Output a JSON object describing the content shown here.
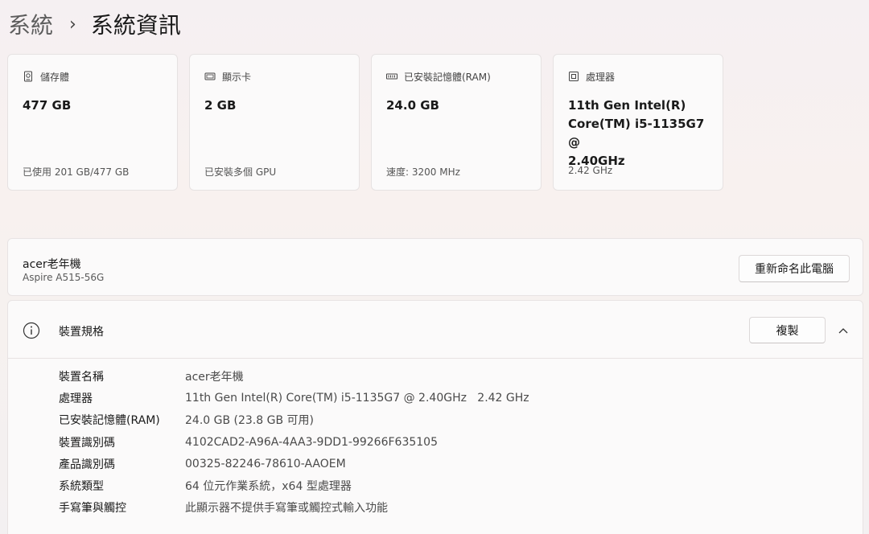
{
  "breadcrumb": {
    "parent": "系統",
    "separator": "›",
    "current": "系統資訊"
  },
  "cards": [
    {
      "icon": "storage-icon",
      "title": "儲存體",
      "value": "477 GB",
      "sub": "已使用 201 GB/477 GB"
    },
    {
      "icon": "display-adapter-icon",
      "title": "顯示卡",
      "value": "2 GB",
      "sub": "已安裝多個 GPU"
    },
    {
      "icon": "memory-icon",
      "title": "已安裝記憶體(RAM)",
      "value": "24.0 GB",
      "sub": "速度: 3200 MHz"
    },
    {
      "icon": "processor-icon",
      "title": "處理器",
      "value_lines": [
        "11th Gen Intel(R)",
        "Core(TM) i5-1135G7 @",
        "2.40GHz"
      ],
      "sub": "2.42 GHz"
    }
  ],
  "device": {
    "name": "acer老年機",
    "model": "Aspire A515-56G",
    "rename_label": "重新命名此電腦"
  },
  "specs": {
    "title": "裝置規格",
    "copy_label": "複製",
    "rows": [
      {
        "label": "裝置名稱",
        "value": "acer老年機"
      },
      {
        "label": "處理器",
        "value": "11th Gen Intel(R) Core(TM) i5-1135G7 @ 2.40GHz   2.42 GHz"
      },
      {
        "label": "已安裝記憶體(RAM)",
        "value": "24.0 GB (23.8 GB 可用)"
      },
      {
        "label": "裝置識別碼",
        "value": "4102CAD2-A96A-4AA3-9DD1-99266F635105"
      },
      {
        "label": "產品識別碼",
        "value": "00325-82246-78610-AAOEM"
      },
      {
        "label": "系統類型",
        "value": "64 位元作業系統，x64 型處理器"
      },
      {
        "label": "手寫筆與觸控",
        "value": "此顯示器不提供手寫筆或觸控式輸入功能"
      }
    ]
  }
}
